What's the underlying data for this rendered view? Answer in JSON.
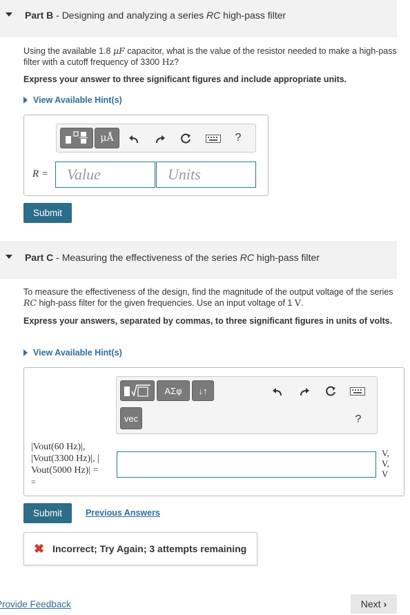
{
  "partB": {
    "label": "Part B",
    "sep": " - ",
    "title_pre": "Designing and analyzing a series ",
    "title_rc": "RC",
    "title_post": " high-pass filter",
    "prompt_pre": "Using the available 1.8 ",
    "prompt_unit1": "μF",
    "prompt_mid": " capacitor, what is the value of the resistor needed to make a high-pass filter with a cutoff frequency of 3300 ",
    "prompt_unit2": "Hz",
    "prompt_post": "?",
    "instruction": "Express your answer to three significant figures and include appropriate units.",
    "hint": "View Available Hint(s)",
    "toolbar": {
      "templates_icon": "fraction-template-icon",
      "units_label": "μÅ",
      "undo_icon": "undo-icon",
      "redo_icon": "redo-icon",
      "reset_icon": "reset-icon",
      "keyboard_icon": "keyboard-icon",
      "help_label": "?"
    },
    "answer_label": "R =",
    "value_placeholder": "Value",
    "units_placeholder": "Units",
    "submit": "Submit"
  },
  "partC": {
    "label": "Part C",
    "sep": " - ",
    "title_pre": "Measuring the effectiveness of the series ",
    "title_rc": "RC",
    "title_post": " high-pass filter",
    "prompt_pre": "To measure the effectiveness of the design, find the magnitude of the output voltage of the series ",
    "prompt_rc": "RC",
    "prompt_mid": " high-pass filter for the given frequencies. Use an input voltage of 1 ",
    "prompt_unit": "V",
    "prompt_post": ".",
    "instruction": "Express your answers, separated by commas, to three significant figures in units of volts.",
    "hint": "View Available Hint(s)",
    "toolbar": {
      "templates_icon": "sqrt-template-icon",
      "greek_label": "ΑΣφ",
      "sort_label": "↓↑",
      "vec_label": "vec",
      "undo_icon": "undo-icon",
      "redo_icon": "redo-icon",
      "reset_icon": "reset-icon",
      "keyboard_icon": "keyboard-icon",
      "help_label": "?"
    },
    "labels": {
      "l1": "|Vout(60 Hz)|,",
      "l2": "|Vout(3300 Hz)|, |",
      "l3": "Vout(5000 Hz)| =",
      "l4": "="
    },
    "units": [
      "V,",
      "V,",
      "V"
    ],
    "submit": "Submit",
    "previous_answers": "Previous Answers",
    "feedback": "Incorrect; Try Again; 3 attempts remaining"
  },
  "footer": {
    "provide_feedback": "Provide Feedback",
    "next": "Next"
  }
}
